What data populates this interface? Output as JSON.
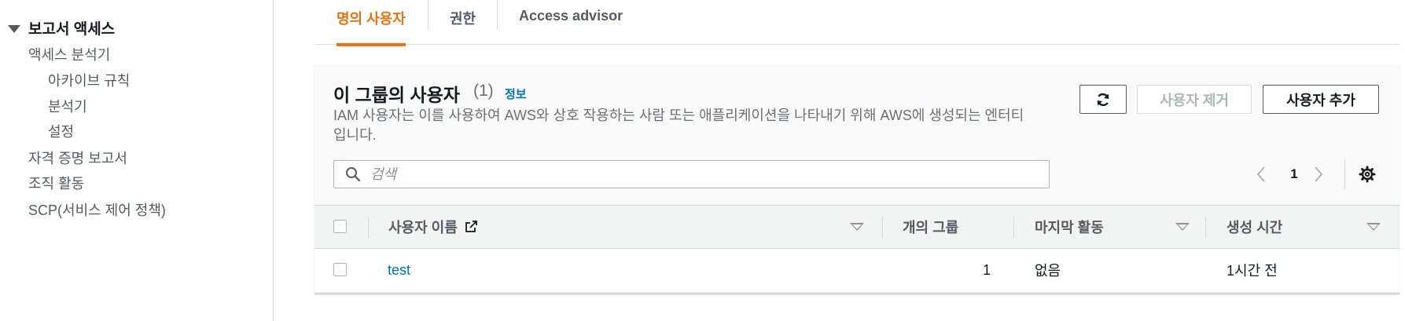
{
  "sidebar": {
    "header": "보고서 액세스",
    "items": [
      {
        "label": "액세스 분석기",
        "level": 1
      },
      {
        "label": "아카이브 규칙",
        "level": 2
      },
      {
        "label": "분석기",
        "level": 2
      },
      {
        "label": "설정",
        "level": 2
      },
      {
        "label": "자격 증명 보고서",
        "level": 1
      },
      {
        "label": "조직 활동",
        "level": 1
      },
      {
        "label": "SCP(서비스 제어 정책)",
        "level": 1
      }
    ]
  },
  "tabs": [
    {
      "label": "명의 사용자",
      "active": true
    },
    {
      "label": "권한",
      "active": false
    },
    {
      "label": "Access advisor",
      "active": false
    }
  ],
  "panel": {
    "title": "이 그룹의 사용자",
    "count": "(1)",
    "info_link": "정보",
    "description": "IAM 사용자는 이를 사용하여 AWS와 상호 작용하는 사람 또는 애플리케이션을 나타내기 위해 AWS에 생성되는 엔터티입니다.",
    "buttons": {
      "refresh_icon": "refresh-icon",
      "remove_label": "사용자 제거",
      "remove_disabled": true,
      "add_label": "사용자 추가"
    },
    "search": {
      "placeholder": "검색",
      "value": ""
    },
    "pagination": {
      "current_page": "1"
    }
  },
  "table": {
    "columns": [
      {
        "label": "사용자 이름",
        "sortable": true,
        "external_icon": "external-link-icon"
      },
      {
        "label": "개의 그룹",
        "sortable": false
      },
      {
        "label": "마지막 활동",
        "sortable": true
      },
      {
        "label": "생성 시간",
        "sortable": true
      }
    ],
    "rows": [
      {
        "user_name": "test",
        "groups": "1",
        "last_activity": "없음",
        "created": "1시간 전"
      }
    ]
  },
  "colors": {
    "accent": "#ec7211",
    "link": "#0073bb",
    "text": "#16191f",
    "muted": "#687078"
  }
}
